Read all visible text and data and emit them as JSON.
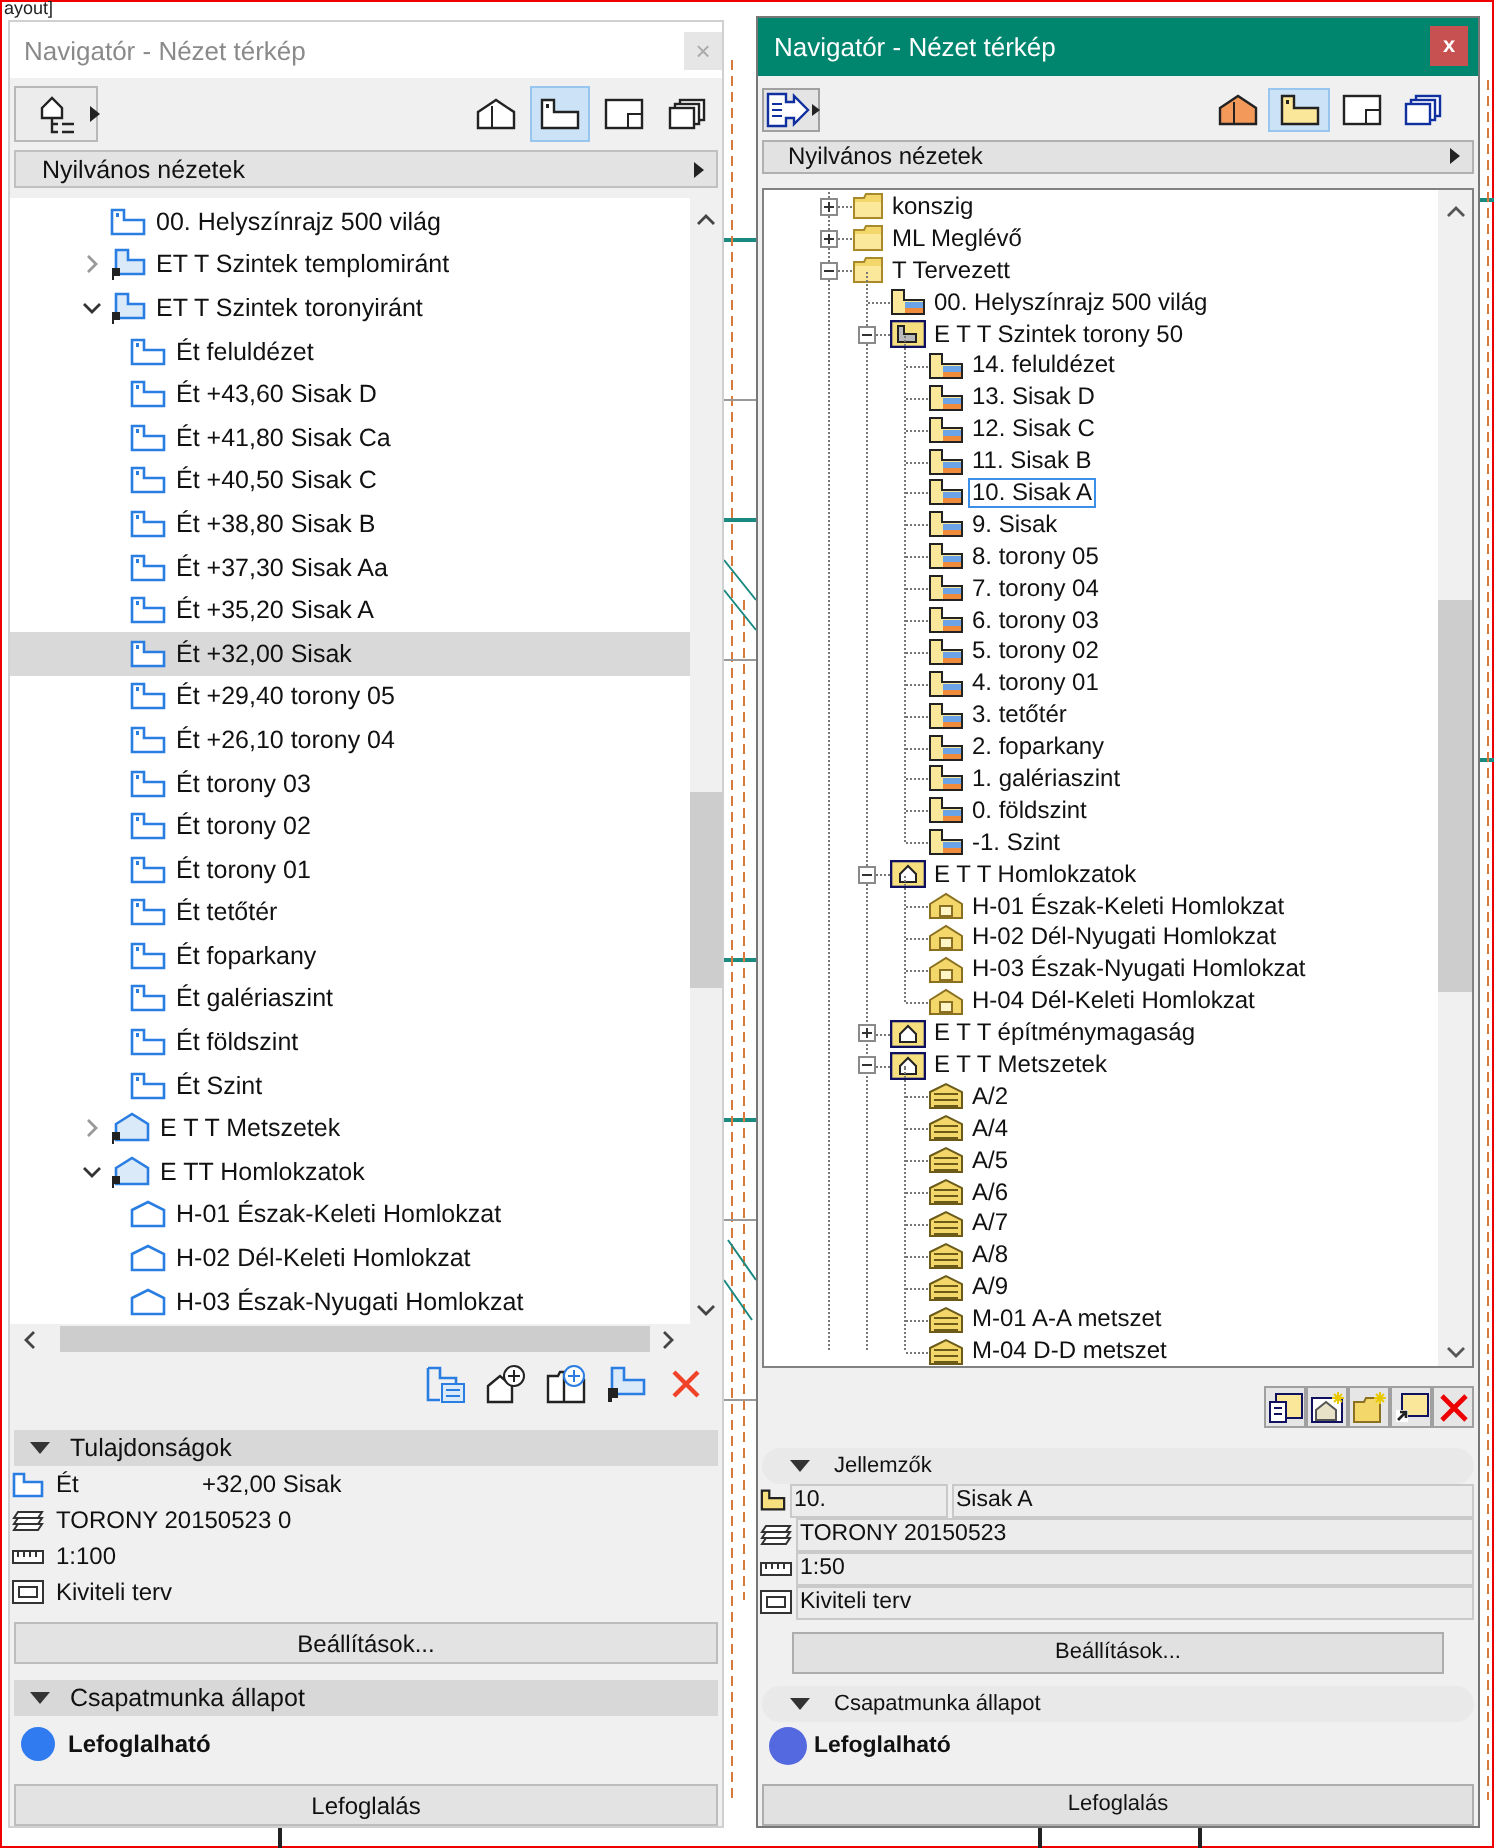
{
  "background": {
    "tab_title": "ayout]"
  },
  "left_window": {
    "title": "Navigatór - Nézet térkép",
    "close": "×",
    "view_buttons": [
      {
        "kind": "house",
        "selected": false
      },
      {
        "kind": "plan",
        "selected": true
      },
      {
        "kind": "sheet",
        "selected": false
      },
      {
        "kind": "stack",
        "selected": false
      }
    ],
    "view_set": "Nyilvános nézetek",
    "tree": [
      {
        "label": "00. Helyszínrajz 500 világ",
        "kind": "floor",
        "selected": false
      },
      {
        "label": "ET T Szintek templomiránt",
        "kind": "floor-group",
        "expanded": false,
        "selected": false
      },
      {
        "label": "ET T Szintek toronyiránt",
        "kind": "floor-group",
        "expanded": true,
        "selected": false,
        "children": [
          {
            "label": "Ét feluldézet",
            "kind": "floor",
            "selected": false
          },
          {
            "label": "Ét +43,60 Sisak D",
            "kind": "floor",
            "selected": false
          },
          {
            "label": "Ét +41,80 Sisak Ca",
            "kind": "floor",
            "selected": false
          },
          {
            "label": "Ét +40,50 Sisak C",
            "kind": "floor",
            "selected": false
          },
          {
            "label": "Ét +38,80 Sisak B",
            "kind": "floor",
            "selected": false
          },
          {
            "label": "Ét +37,30 Sisak Aa",
            "kind": "floor",
            "selected": false
          },
          {
            "label": "Ét +35,20 Sisak A",
            "kind": "floor",
            "selected": false
          },
          {
            "label": "Ét +32,00 Sisak",
            "kind": "floor",
            "selected": true
          },
          {
            "label": "Ét +29,40 torony 05",
            "kind": "floor",
            "selected": false
          },
          {
            "label": "Ét +26,10 torony 04",
            "kind": "floor",
            "selected": false
          },
          {
            "label": "Ét torony 03",
            "kind": "floor",
            "selected": false
          },
          {
            "label": "Ét torony 02",
            "kind": "floor",
            "selected": false
          },
          {
            "label": "Ét torony 01",
            "kind": "floor",
            "selected": false
          },
          {
            "label": "Ét tetőtér",
            "kind": "floor",
            "selected": false
          },
          {
            "label": "Ét foparkany",
            "kind": "floor",
            "selected": false
          },
          {
            "label": "Ét galériaszint",
            "kind": "floor",
            "selected": false
          },
          {
            "label": "Ét földszint",
            "kind": "floor",
            "selected": false
          },
          {
            "label": "Ét Szint",
            "kind": "floor",
            "selected": false
          }
        ]
      },
      {
        "label": "E T T Metszetek",
        "kind": "elevation-group",
        "expanded": false,
        "selected": false
      },
      {
        "label": "E TT Homlokzatok",
        "kind": "elevation-group",
        "expanded": true,
        "selected": false,
        "children": [
          {
            "label": "H-01 Észak-Keleti Homlokzat",
            "kind": "elevation",
            "selected": false
          },
          {
            "label": "H-02 Dél-Keleti Homlokzat",
            "kind": "elevation",
            "selected": false
          },
          {
            "label": "H-03 Észak-Nyugati Homlokzat",
            "kind": "elevation",
            "selected": false
          }
        ]
      }
    ],
    "properties": {
      "header": "Tulajdonságok",
      "expanded": true,
      "rows": [
        {
          "kind": "story",
          "values": [
            "Ét",
            "+32,00 Sisak"
          ]
        },
        {
          "kind": "layer",
          "values": [
            "TORONY 20150523 0"
          ]
        },
        {
          "kind": "scale",
          "values": [
            "1:100"
          ]
        },
        {
          "kind": "model",
          "values": [
            "Kiviteli terv"
          ]
        }
      ],
      "button": "Beállítások..."
    },
    "teamwork": {
      "header": "Csapatmunka állapot",
      "expanded": true,
      "status": "Lefoglalható",
      "color": "#2f7bef",
      "button": "Lefoglalás"
    }
  },
  "right_window": {
    "title": "Navigatór - Nézet térkép",
    "close": "x",
    "view_buttons": [
      {
        "kind": "house",
        "selected": false
      },
      {
        "kind": "plan",
        "selected": true
      },
      {
        "kind": "sheet",
        "selected": false
      },
      {
        "kind": "stack",
        "selected": false
      }
    ],
    "view_set": "Nyilvános nézetek",
    "tree": [
      {
        "label": "konszig",
        "kind": "folder",
        "expanded": false,
        "selected": false
      },
      {
        "label": "ML Meglévő",
        "kind": "folder",
        "expanded": false,
        "selected": false
      },
      {
        "label": "T Tervezett",
        "kind": "folder",
        "expanded": true,
        "selected": false,
        "children": [
          {
            "label": "00. Helyszínrajz 500 világ",
            "kind": "floor",
            "selected": false
          },
          {
            "label": "E T T Szintek torony 50",
            "kind": "floor-group",
            "expanded": true,
            "selected": false,
            "children": [
              {
                "label": "14. feluldézet",
                "kind": "floor",
                "selected": false
              },
              {
                "label": "13. Sisak D",
                "kind": "floor",
                "selected": false
              },
              {
                "label": "12. Sisak C",
                "kind": "floor",
                "selected": false
              },
              {
                "label": "11. Sisak B",
                "kind": "floor",
                "selected": false
              },
              {
                "label": "10. Sisak A",
                "kind": "floor",
                "selected": true
              },
              {
                "label": "9. Sisak",
                "kind": "floor",
                "selected": false
              },
              {
                "label": "8. torony 05",
                "kind": "floor",
                "selected": false
              },
              {
                "label": "7. torony 04",
                "kind": "floor",
                "selected": false
              },
              {
                "label": "6. torony 03",
                "kind": "floor",
                "selected": false
              },
              {
                "label": "5. torony 02",
                "kind": "floor",
                "selected": false
              },
              {
                "label": "4. torony 01",
                "kind": "floor",
                "selected": false
              },
              {
                "label": "3. tetőtér",
                "kind": "floor",
                "selected": false
              },
              {
                "label": "2. foparkany",
                "kind": "floor",
                "selected": false
              },
              {
                "label": "1. galériaszint",
                "kind": "floor",
                "selected": false
              },
              {
                "label": "0. földszint",
                "kind": "floor",
                "selected": false
              },
              {
                "label": "-1. Szint",
                "kind": "floor",
                "selected": false
              }
            ]
          },
          {
            "label": "E T T Homlokzatok",
            "kind": "elevation-group",
            "expanded": true,
            "selected": false,
            "children": [
              {
                "label": "H-01 Észak-Keleti Homlokzat",
                "kind": "elevation",
                "selected": false
              },
              {
                "label": "H-02 Dél-Nyugati Homlokzat",
                "kind": "elevation",
                "selected": false
              },
              {
                "label": "H-03 Észak-Nyugati Homlokzat",
                "kind": "elevation",
                "selected": false
              },
              {
                "label": "H-04 Dél-Keleti Homlokzat",
                "kind": "elevation",
                "selected": false
              }
            ]
          },
          {
            "label": "E T T építménymagaság",
            "kind": "elevation-group",
            "expanded": false,
            "selected": false
          },
          {
            "label": "E T T Metszetek",
            "kind": "elevation-group",
            "expanded": true,
            "selected": false,
            "children": [
              {
                "label": "A/2",
                "kind": "section",
                "selected": false
              },
              {
                "label": "A/4",
                "kind": "section",
                "selected": false
              },
              {
                "label": "A/5",
                "kind": "section",
                "selected": false
              },
              {
                "label": "A/6",
                "kind": "section",
                "selected": false
              },
              {
                "label": "A/7",
                "kind": "section",
                "selected": false
              },
              {
                "label": "A/8",
                "kind": "section",
                "selected": false
              },
              {
                "label": "A/9",
                "kind": "section",
                "selected": false
              },
              {
                "label": "M-01 A-A metszet",
                "kind": "section",
                "selected": false
              },
              {
                "label": "M-04 D-D metszet",
                "kind": "section",
                "selected": false
              }
            ]
          }
        ]
      }
    ],
    "properties": {
      "header": "Jellemzők",
      "expanded": true,
      "rows": [
        {
          "kind": "story",
          "values": [
            "10.",
            "Sisak A"
          ]
        },
        {
          "kind": "layer",
          "values": [
            "TORONY 20150523"
          ]
        },
        {
          "kind": "scale",
          "values": [
            "1:50"
          ]
        },
        {
          "kind": "model",
          "values": [
            "Kiviteli terv"
          ]
        }
      ],
      "button": "Beállítások..."
    },
    "teamwork": {
      "header": "Csapatmunka állapot",
      "expanded": true,
      "status": "Lefoglalható",
      "color": "#5468e0",
      "button": "Lefoglalás"
    }
  }
}
